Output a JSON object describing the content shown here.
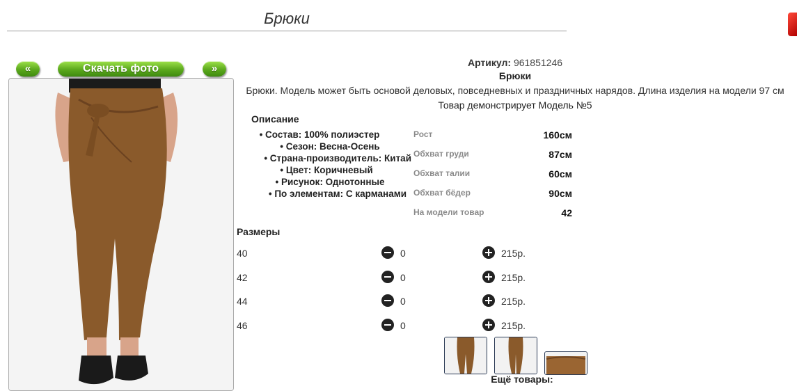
{
  "header": {
    "title": "Брюки"
  },
  "nav": {
    "prev_label": "«",
    "download_label": "Скачать фото",
    "next_label": "»"
  },
  "product": {
    "article_label": "Артикул:",
    "article_value": "961851246",
    "name": "Брюки",
    "description": "Брюки. Модель может быть основой деловых, повседневных и праздничных нарядов. Длина изделия на модели 97 см",
    "model_line": "Товар демонстрирует Модель №5"
  },
  "description_block": {
    "title": "Описание",
    "items": [
      "• Состав: 100% полиэстер",
      "• Сезон: Весна-Осень",
      "• Страна-производитель: Китай",
      "• Цвет: Коричневый",
      "• Рисунок: Однотонные",
      "• По элементам: С карманами"
    ]
  },
  "measurements": [
    {
      "label": "Рост",
      "value": "160см"
    },
    {
      "label": "Обхват груди",
      "value": "87см"
    },
    {
      "label": "Обхват талии",
      "value": "60см"
    },
    {
      "label": "Обхват бёдер",
      "value": "90см"
    },
    {
      "label": "На модели товар",
      "value": "42"
    }
  ],
  "sizes": {
    "title": "Размеры",
    "rows": [
      {
        "size": "40",
        "qty": "0",
        "price": "215р."
      },
      {
        "size": "42",
        "qty": "0",
        "price": "215р."
      },
      {
        "size": "44",
        "qty": "0",
        "price": "215р."
      },
      {
        "size": "46",
        "qty": "0",
        "price": "215р."
      }
    ]
  },
  "more_label": "Ещё товары:",
  "colors": {
    "pants": "#8a5a2b",
    "accent_green": "#5ba81d",
    "close_red": "#d01010"
  },
  "icons": [
    "close-icon",
    "minus-icon",
    "plus-icon"
  ]
}
